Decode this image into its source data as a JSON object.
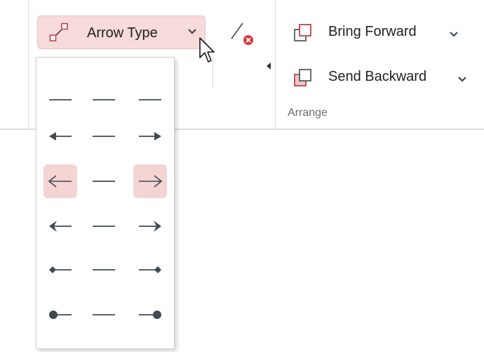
{
  "ribbon": {
    "arrow_type_label": "Arrow Type",
    "bring_forward_label": "Bring Forward",
    "send_backward_label": "Send Backward",
    "arrange_group_label": "Arrange"
  },
  "dropdown": {
    "rows": [
      {
        "start": "none",
        "end": "none"
      },
      {
        "start": "triangle",
        "end": "triangle"
      },
      {
        "start": "open",
        "end": "open",
        "selected": true
      },
      {
        "start": "stealth",
        "end": "stealth"
      },
      {
        "start": "diamond",
        "end": "diamond"
      },
      {
        "start": "oval",
        "end": "oval"
      }
    ]
  },
  "colors": {
    "accent": "#c2424b",
    "selection_bg": "#f5d4d4",
    "icon_dark": "#3f4a52",
    "separator": "#dcdcdc"
  }
}
